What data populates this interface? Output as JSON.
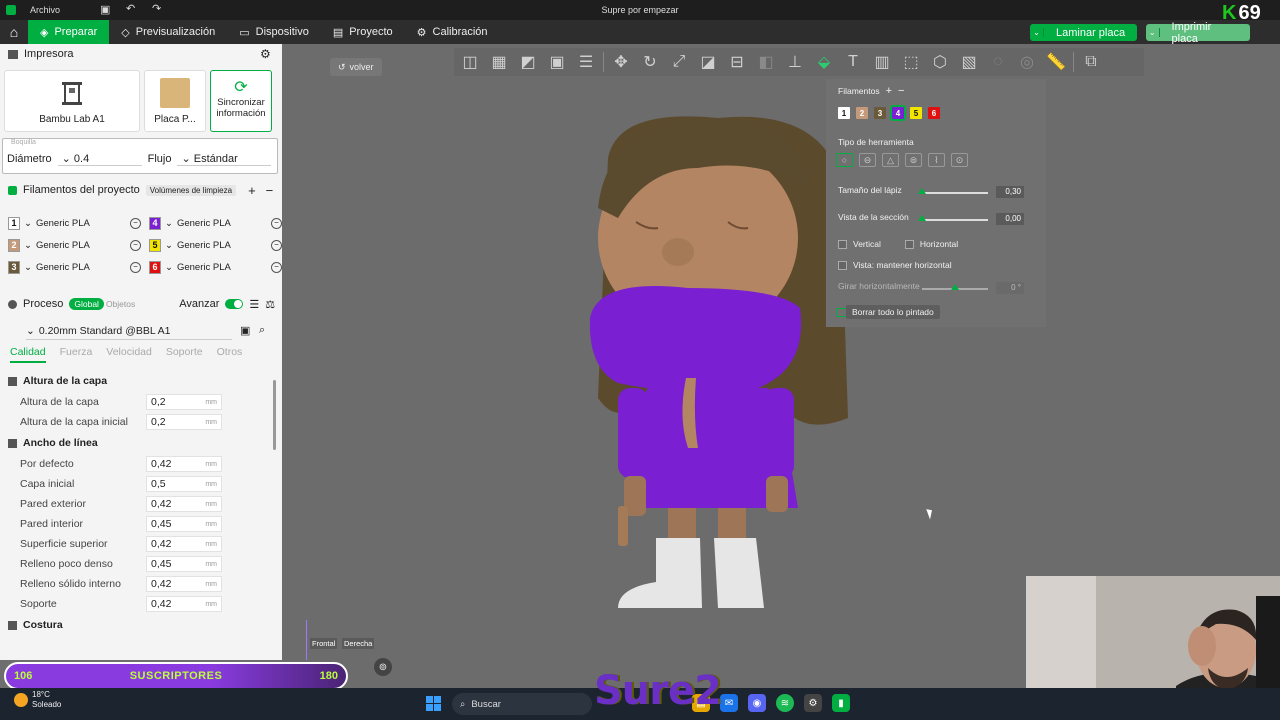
{
  "titlebar": {
    "menu": "Archivo",
    "title": "Supre por empezar"
  },
  "tabs": [
    {
      "label": "Preparar"
    },
    {
      "label": "Previsualización"
    },
    {
      "label": "Dispositivo"
    },
    {
      "label": "Proyecto"
    },
    {
      "label": "Calibración"
    }
  ],
  "actions": {
    "slice": "Laminar placa",
    "print": "Imprimir placa"
  },
  "stream_badge": "69",
  "printer": {
    "section_title": "Impresora",
    "printer_name": "Bambu Lab A1",
    "plate_name": "Placa P...",
    "sync_label": "Sincronizar información",
    "nozzle_hint": "Boquilla",
    "diameter_label": "Diámetro",
    "diameter_value": "0.4",
    "flow_label": "Flujo",
    "flow_value": "Estándar"
  },
  "filaments": {
    "section_title": "Filamentos del proyecto",
    "purge_button": "Volúmenes de limpieza",
    "items": [
      {
        "num": "1",
        "name": "Generic PLA",
        "color": "#ffffff"
      },
      {
        "num": "2",
        "name": "Generic PLA",
        "color": "#c49a7a"
      },
      {
        "num": "3",
        "name": "Generic PLA",
        "color": "#6b5a3a"
      },
      {
        "num": "4",
        "name": "Generic PLA",
        "color": "#7a1fd1"
      },
      {
        "num": "5",
        "name": "Generic PLA",
        "color": "#f2e600"
      },
      {
        "num": "6",
        "name": "Generic PLA",
        "color": "#e01010"
      }
    ]
  },
  "process": {
    "section_title": "Proceso",
    "global_pill": "Global",
    "objects_label": "Objetos",
    "advanced_label": "Avanzar",
    "preset": "0.20mm Standard @BBL A1",
    "subtabs": [
      "Calidad",
      "Fuerza",
      "Velocidad",
      "Soporte",
      "Otros"
    ],
    "groups": [
      {
        "title": "Altura de la capa",
        "params": [
          {
            "name": "Altura de la capa",
            "value": "0,2",
            "unit": "mm"
          },
          {
            "name": "Altura de la capa inicial",
            "value": "0,2",
            "unit": "mm"
          }
        ]
      },
      {
        "title": "Ancho de línea",
        "params": [
          {
            "name": "Por defecto",
            "value": "0,42",
            "unit": "mm"
          },
          {
            "name": "Capa inicial",
            "value": "0,5",
            "unit": "mm"
          },
          {
            "name": "Pared exterior",
            "value": "0,42",
            "unit": "mm"
          },
          {
            "name": "Pared interior",
            "value": "0,45",
            "unit": "mm"
          },
          {
            "name": "Superficie superior",
            "value": "0,42",
            "unit": "mm"
          },
          {
            "name": "Relleno poco denso",
            "value": "0,45",
            "unit": "mm"
          },
          {
            "name": "Relleno sólido interno",
            "value": "0,42",
            "unit": "mm"
          },
          {
            "name": "Soporte",
            "value": "0,42",
            "unit": "mm"
          }
        ]
      },
      {
        "title": "Costura",
        "params": []
      }
    ]
  },
  "viewport": {
    "back_label": "volver",
    "gizmo_front": "Frontal",
    "gizmo_right": "Derecha"
  },
  "paint_panel": {
    "filaments_label": "Filamentos",
    "tool_type_label": "Tipo de herramienta",
    "pen_size_label": "Tamaño del lápiz",
    "pen_size_value": "0,30",
    "pen_size_level": 0.0,
    "section_view_label": "Vista de la sección",
    "section_view_value": "0,00",
    "section_view_level": 0.0,
    "vertical_label": "Vertical",
    "horizontal_label": "Horizontal",
    "keep_horizontal_label": "Vista: mantener horizontal",
    "rotate_label": "Girar horizontalmente",
    "rotate_value": "0 °",
    "rotate_level": 0.5,
    "clear_label": "Borrar todo lo pintado",
    "selected_filament": "4"
  },
  "overlay": {
    "subs_low": "106",
    "subs_label": "SUSCRIPTORES",
    "subs_high": "180",
    "logo_text": "Sure2"
  },
  "taskbar": {
    "temp": "18°C",
    "weather": "Soleado",
    "search": "Buscar"
  }
}
